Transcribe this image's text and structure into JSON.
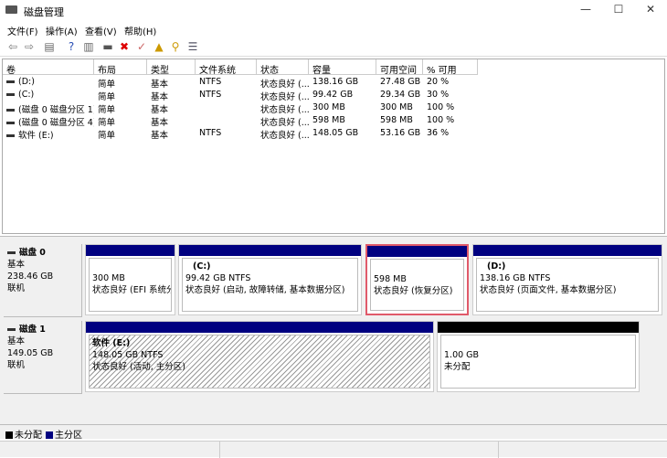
{
  "window": {
    "title": "磁盘管理",
    "minimize": "—",
    "maximize": "☐",
    "close": "✕"
  },
  "menu": [
    "文件(F)",
    "操作(A)",
    "查看(V)",
    "帮助(H)"
  ],
  "toolbar": [
    {
      "icon": "back-icon",
      "glyph": "⇦"
    },
    {
      "icon": "forward-icon",
      "glyph": "⇨"
    },
    {
      "icon": "show-hide-tree-icon",
      "glyph": "▤"
    },
    {
      "icon": "help-icon",
      "glyph": "?"
    },
    {
      "icon": "show-hide-action-pane-icon",
      "glyph": "▥"
    },
    {
      "icon": "connect-disk-icon",
      "glyph": "▬"
    },
    {
      "icon": "delete-icon",
      "glyph": "✖"
    },
    {
      "icon": "properties-icon",
      "glyph": "✓"
    },
    {
      "icon": "open-folder-icon",
      "glyph": "▲"
    },
    {
      "icon": "explore-icon",
      "glyph": "⚲"
    },
    {
      "icon": "list-icon",
      "glyph": "☰"
    }
  ],
  "table": {
    "columns": [
      "卷",
      "布局",
      "类型",
      "文件系统",
      "状态",
      "容量",
      "可用空间",
      "% 可用"
    ],
    "rows": [
      [
        "(D:)",
        "简单",
        "基本",
        "NTFS",
        "状态良好 (...",
        "138.16 GB",
        "27.48 GB",
        "20 %"
      ],
      [
        "(C:)",
        "简单",
        "基本",
        "NTFS",
        "状态良好 (...",
        "99.42 GB",
        "29.34 GB",
        "30 %"
      ],
      [
        "(磁盘 0 磁盘分区 1)",
        "简单",
        "基本",
        "",
        "状态良好 (...",
        "300 MB",
        "300 MB",
        "100 %"
      ],
      [
        "(磁盘 0 磁盘分区 4)",
        "简单",
        "基本",
        "",
        "状态良好 (...",
        "598 MB",
        "598 MB",
        "100 %"
      ],
      [
        "软件 (E:)",
        "简单",
        "基本",
        "NTFS",
        "状态良好 (...",
        "148.05 GB",
        "53.16 GB",
        "36 %"
      ]
    ]
  },
  "disks": [
    {
      "name": "磁盘 0",
      "type": "基本",
      "size": "238.46 GB",
      "status": "联机",
      "partitions": [
        {
          "label": "",
          "size": "300 MB",
          "status": "状态良好 (EFI 系统分[",
          "kind": "primary"
        },
        {
          "label": "(C:)",
          "size": "99.42 GB NTFS",
          "status": "状态良好 (启动, 故障转储, 基本数据分区)",
          "kind": "primary"
        },
        {
          "label": "",
          "size": "598 MB",
          "status": "状态良好 (恢复分区)",
          "kind": "primary",
          "selected": true
        },
        {
          "label": "(D:)",
          "size": "138.16 GB NTFS",
          "status": "状态良好 (页面文件, 基本数据分区)",
          "kind": "primary"
        }
      ]
    },
    {
      "name": "磁盘 1",
      "type": "基本",
      "size": "149.05 GB",
      "status": "联机",
      "partitions": [
        {
          "label": "软件  (E:)",
          "size": "148.05 GB NTFS",
          "status": "状态良好 (活动, 主分区)",
          "kind": "primary",
          "hatched": true
        },
        {
          "label": "",
          "size": "1.00 GB",
          "status": "未分配",
          "kind": "unallocated"
        }
      ]
    }
  ],
  "legend": [
    {
      "label": "未分配",
      "color": "#000000"
    },
    {
      "label": "主分区",
      "color": "#000080"
    }
  ],
  "colors": {
    "primary": "#000080",
    "unallocated": "#000000",
    "selection": "#e05a6a"
  }
}
